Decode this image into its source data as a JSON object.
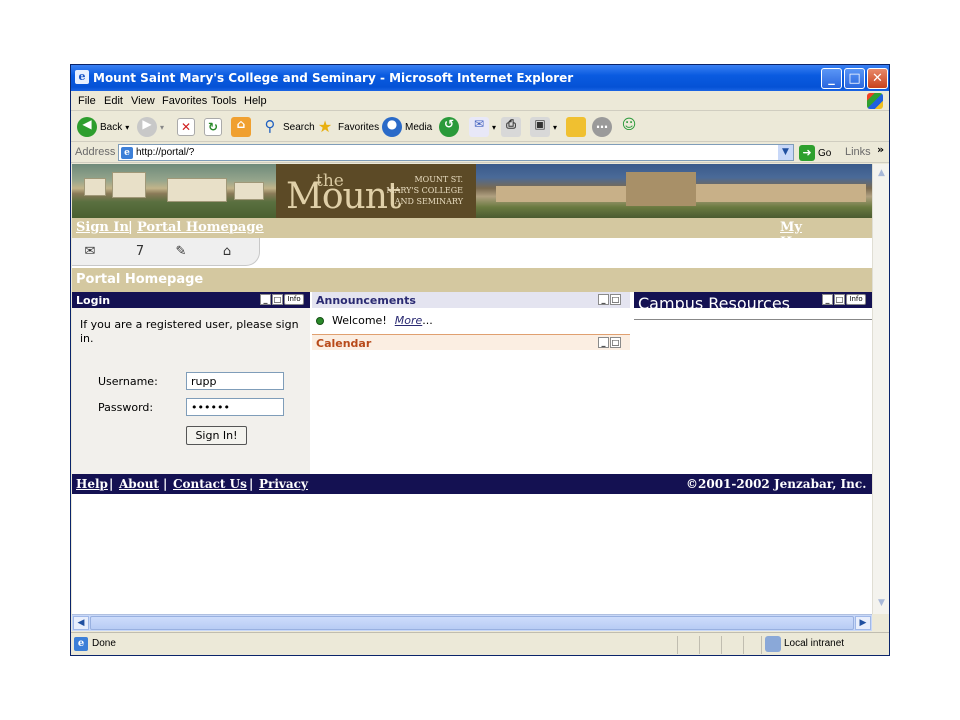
{
  "window": {
    "title": "Mount Saint Mary's College and Seminary - Microsoft Internet Explorer",
    "minimize": "_",
    "maximize": "□",
    "close": "✕"
  },
  "menu": [
    "File",
    "Edit",
    "View",
    "Favorites",
    "Tools",
    "Help"
  ],
  "toolbar": {
    "back": "Back",
    "search": "Search",
    "favorites": "Favorites",
    "media": "Media"
  },
  "address": {
    "label": "Address",
    "url": "http://portal/?",
    "go": "Go",
    "links": "Links",
    "chevron": "»"
  },
  "banner": {
    "the": "the",
    "mount": "Mount",
    "college_lines": [
      "MOUNT ST.",
      "MARY'S COLLEGE",
      "AND SEMINARY"
    ]
  },
  "nav": {
    "sign_in": "Sign In",
    "separator": "|",
    "portal_homepage": "Portal Homepage",
    "my_homepage": "My Homepage"
  },
  "page_header": "Portal Homepage",
  "login": {
    "title": "Login",
    "info": "Info",
    "message": "If you are a registered user, please sign in.",
    "username_label": "Username:",
    "username_value": "rupp",
    "password_label": "Password:",
    "password_value": "••••••",
    "button": "Sign In!"
  },
  "announcements": {
    "title": "Announcements",
    "item": "Welcome!",
    "more": "More",
    "ellipsis": "..."
  },
  "calendar": {
    "title": "Calendar"
  },
  "campus_resources": {
    "title": "Campus Resources",
    "info": "Info"
  },
  "footer": {
    "links": [
      "Help",
      "About",
      "Contact Us",
      "Privacy"
    ],
    "separator": "|",
    "copyright": "©2001-2002 Jenzabar, Inc."
  },
  "status": {
    "text": "Done",
    "zone": "Local intranet"
  },
  "colors": {
    "portlet_dark": "#141152",
    "tan": "#d4c8a0",
    "calendar_accent": "#b84a1a",
    "xp_blue": "#0552d6"
  }
}
